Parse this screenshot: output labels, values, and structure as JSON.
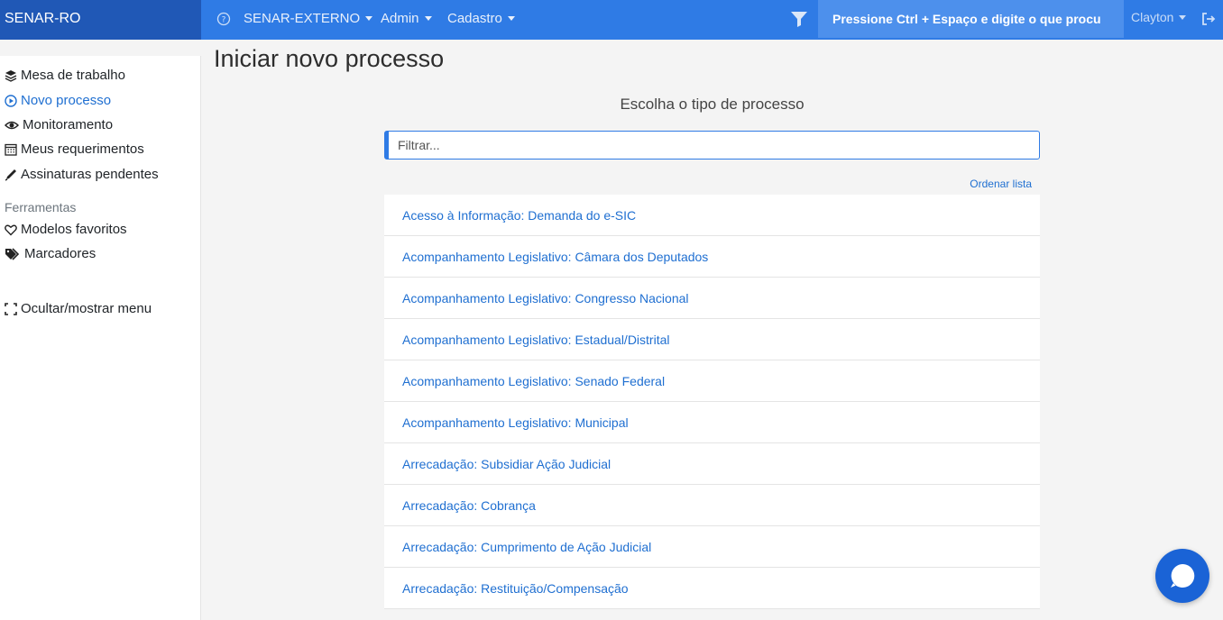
{
  "header": {
    "brand": "SENAR-RO",
    "nav": [
      {
        "label": "SENAR-EXTERNO"
      },
      {
        "label": "Admin"
      },
      {
        "label": "Cadastro"
      }
    ],
    "search_text": "Pressione Ctrl + Espaço e digite o que procu",
    "user": "Clayton",
    "accent": "#2f7be5",
    "brand_bg": "#2058b6"
  },
  "sidebar": {
    "items": [
      {
        "label": "Mesa de trabalho",
        "icon": "layers-icon"
      },
      {
        "label": "Novo processo",
        "icon": "play-circle-icon",
        "active": true
      },
      {
        "label": "Monitoramento",
        "icon": "eye-icon"
      },
      {
        "label": "Meus requerimentos",
        "icon": "calendar-icon"
      },
      {
        "label": "Assinaturas pendentes",
        "icon": "pen-icon"
      }
    ],
    "section_title": "Ferramentas",
    "tools": [
      {
        "label": "Modelos favoritos",
        "icon": "heart-icon"
      },
      {
        "label": "Marcadores",
        "icon": "tags-icon"
      }
    ],
    "toggle_label": "Ocultar/mostrar menu"
  },
  "main": {
    "title": "Iniciar novo processo",
    "subtitle": "Escolha o tipo de processo",
    "filter_placeholder": "Filtrar...",
    "order_label": "Ordenar lista",
    "process_types": [
      "Acesso à Informação: Demanda do e-SIC",
      "Acompanhamento Legislativo: Câmara dos Deputados",
      "Acompanhamento Legislativo: Congresso Nacional",
      "Acompanhamento Legislativo: Estadual/Distrital",
      "Acompanhamento Legislativo: Senado Federal",
      "Acompanhamento Legislativo: Municipal",
      "Arrecadação: Subsidiar Ação Judicial",
      "Arrecadação: Cobrança",
      "Arrecadação: Cumprimento de Ação Judicial",
      "Arrecadação: Restituição/Compensação"
    ],
    "link_color": "#1f6fd1"
  }
}
